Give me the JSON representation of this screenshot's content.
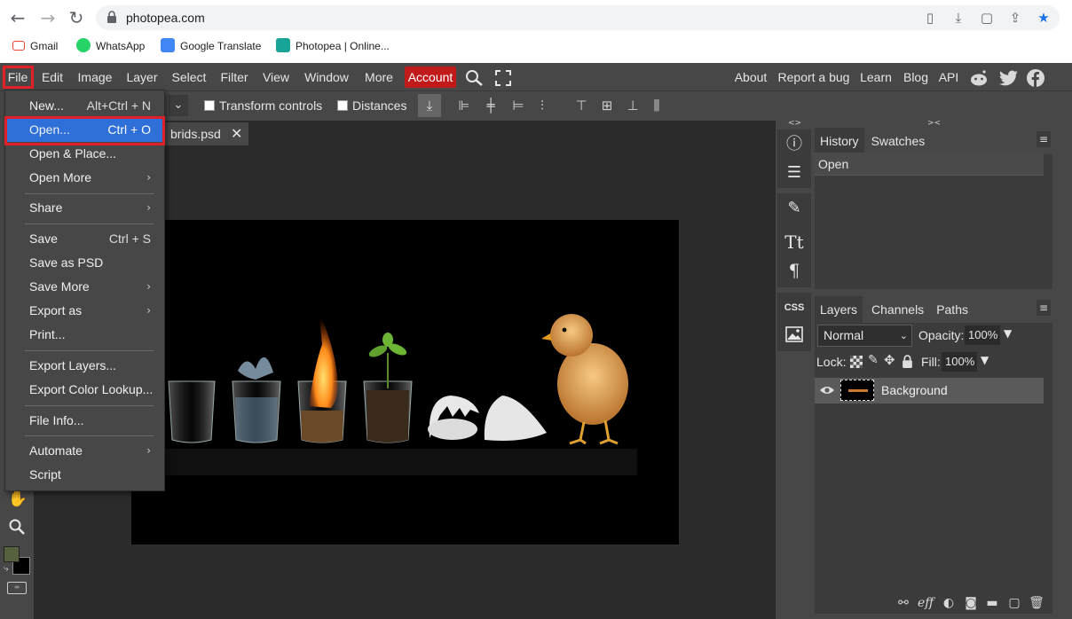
{
  "browser": {
    "url": "photopea.com",
    "bookmarks": [
      "Gmail",
      "WhatsApp",
      "Google Translate",
      "Photopea | Online..."
    ]
  },
  "menubar": {
    "items": [
      "File",
      "Edit",
      "Image",
      "Layer",
      "Select",
      "Filter",
      "View",
      "Window",
      "More"
    ],
    "account": "Account",
    "right_links": [
      "About",
      "Report a bug",
      "Learn",
      "Blog",
      "API"
    ]
  },
  "options": {
    "transform_controls": "Transform controls",
    "distances": "Distances"
  },
  "document": {
    "tab_name": "brids.psd",
    "close": "✕"
  },
  "file_menu": {
    "items": [
      {
        "label": "New...",
        "shortcut": "Alt+Ctrl + N"
      },
      {
        "label": "Open...",
        "shortcut": "Ctrl + O"
      },
      {
        "label": "Open & Place...",
        "shortcut": ""
      },
      {
        "label": "Open More",
        "shortcut": "›"
      },
      {
        "label": "Share",
        "shortcut": "›"
      },
      {
        "label": "Save",
        "shortcut": "Ctrl + S"
      },
      {
        "label": "Save as PSD",
        "shortcut": ""
      },
      {
        "label": "Save More",
        "shortcut": "›"
      },
      {
        "label": "Export as",
        "shortcut": "›"
      },
      {
        "label": "Print...",
        "shortcut": ""
      },
      {
        "label": "Export Layers...",
        "shortcut": ""
      },
      {
        "label": "Export Color Lookup...",
        "shortcut": ""
      },
      {
        "label": "File Info...",
        "shortcut": ""
      },
      {
        "label": "Automate",
        "shortcut": "›"
      },
      {
        "label": "Script",
        "shortcut": ""
      }
    ]
  },
  "history_panel": {
    "tabs": [
      "History",
      "Swatches"
    ],
    "entries": [
      "Open"
    ]
  },
  "layers_panel": {
    "tabs": [
      "Layers",
      "Channels",
      "Paths"
    ],
    "blend_mode": "Normal",
    "opacity_label": "Opacity:",
    "opacity_value": "100%",
    "lock_label": "Lock:",
    "fill_label": "Fill:",
    "fill_value": "100%",
    "layers": [
      "Background"
    ]
  },
  "strip": {
    "css_label": "CSS"
  },
  "colors": {
    "account_bg": "#c11a1a",
    "highlight": "#e01f26",
    "menu_active": "#2e6fd8",
    "foreground": "#56613f",
    "background": "#000000"
  }
}
